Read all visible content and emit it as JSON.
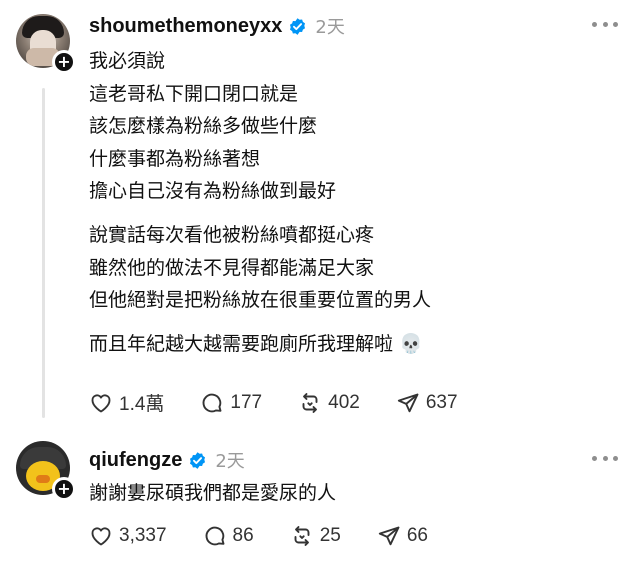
{
  "posts": [
    {
      "username": "shoumethemoneyxx",
      "time": "2天",
      "lines": [
        "我必須說",
        "這老哥私下開口閉口就是",
        "該怎麼樣為粉絲多做些什麼",
        "什麼事都為粉絲著想",
        "擔心自己沒有為粉絲做到最好",
        "說實話每次看他被粉絲噴都挺心疼",
        "雖然他的做法不見得都能滿足大家",
        "但他絕對是把粉絲放在很重要位置的男人",
        "而且年紀越大越需要跑廁所我理解啦 💀"
      ],
      "likes": "1.4萬",
      "replies": "177",
      "reposts": "402",
      "shares": "637"
    },
    {
      "username": "qiufengze",
      "time": "2天",
      "lines": [
        "謝謝婁尿碩我們都是愛尿的人"
      ],
      "likes": "3,337",
      "replies": "86",
      "reposts": "25",
      "shares": "66"
    }
  ],
  "icons": {
    "verified": "verified-badge-icon",
    "like": "heart-icon",
    "reply": "comment-bubble-icon",
    "repost": "repost-arrows-icon",
    "share": "send-paper-plane-icon",
    "more": "more-dots-icon",
    "follow": "plus-icon"
  },
  "colors": {
    "verified": "#0095f6",
    "muted": "#9a9a9a",
    "text": "#111111"
  }
}
